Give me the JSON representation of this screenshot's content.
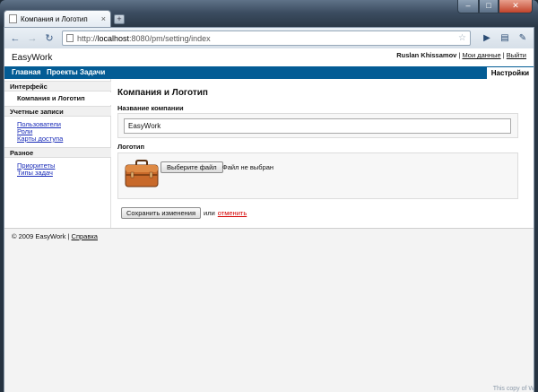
{
  "browser": {
    "tab_title": "Компания и Логотип",
    "tab_close": "×",
    "new_tab": "+",
    "win_min": "–",
    "win_max": "□",
    "win_close": "✕",
    "back": "←",
    "forward": "→",
    "reload": "↻",
    "url_scheme": "http://",
    "url_host": "localhost",
    "url_path": ":8080/pm/setting/index",
    "star": "☆",
    "go": "▶",
    "page_menu": "▤",
    "tools_menu": "✎"
  },
  "site": {
    "brand": "EasyWork",
    "user_name": "Ruslan Khissamov",
    "my_data": "Мои данные",
    "logout": "Выйти",
    "separator": "|"
  },
  "nav": {
    "items": [
      "Главная",
      "Проекты",
      "Задачи"
    ],
    "settings": "Настройки"
  },
  "sidebar": {
    "sections": [
      {
        "title": "Интерфейс"
      },
      {
        "title": "Учетные записи"
      },
      {
        "title": "Разное"
      }
    ],
    "active_item": "Компания и Логотип",
    "accounts_links": [
      "Пользователи",
      "Роли",
      "Карты доступа"
    ],
    "misc_links": [
      "Приоритеты",
      "Типы задач"
    ]
  },
  "main": {
    "title": "Компания и Логотип",
    "company_label": "Название компании",
    "company_value": "EasyWork",
    "logo_label": "Логотип",
    "file_button": "Выберите файл",
    "file_status": "Файл не выбран",
    "save_button": "Сохранить изменения",
    "or_text": "или",
    "cancel_link": "отменить"
  },
  "footer": {
    "copyright": "© 2009 EasyWork | ",
    "help": "Справка"
  },
  "watermark": "This copy of W"
}
